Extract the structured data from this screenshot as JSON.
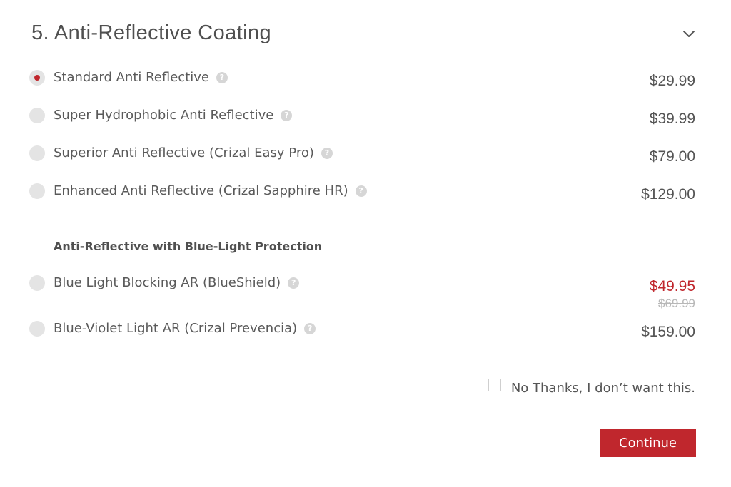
{
  "section": {
    "title": "5. Anti-Reflective Coating",
    "toggle_icon": "chevron-down-icon"
  },
  "options": [
    {
      "label": "Standard Anti Reflective",
      "price": "$29.99",
      "selected": true
    },
    {
      "label": "Super Hydrophobic Anti Reflective",
      "price": "$39.99",
      "selected": false
    },
    {
      "label": "Superior Anti Reflective (Crizal Easy Pro)",
      "price": "$79.00",
      "selected": false
    },
    {
      "label": "Enhanced Anti Reflective (Crizal Sapphire HR)",
      "price": "$129.00",
      "selected": false
    }
  ],
  "blue_light": {
    "heading": "Anti-Reflective with Blue-Light Protection",
    "options": [
      {
        "label": "Blue Light Blocking AR (BlueShield)",
        "price": "$49.95",
        "original_price": "$69.99",
        "selected": false
      },
      {
        "label": "Blue-Violet Light AR (Crizal Prevencia)",
        "price": "$159.00",
        "selected": false
      }
    ]
  },
  "help_icon": "?",
  "no_thanks": {
    "label": "No Thanks, I don’t want this.",
    "checked": false
  },
  "continue_button": {
    "label": "Continue"
  },
  "colors": {
    "accent": "#c0272d",
    "text": "#555555",
    "radio_bg": "#e4e4e4",
    "help_icon_bg": "#d6d6d6",
    "strikethrough": "#b8b8b8"
  }
}
